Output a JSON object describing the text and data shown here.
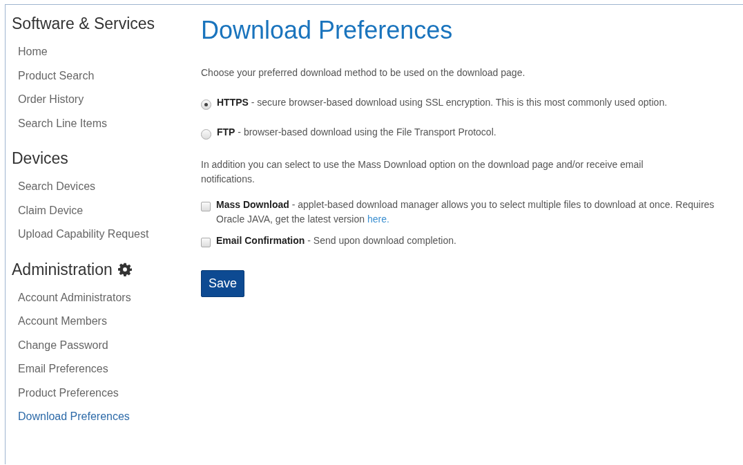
{
  "sidebar": {
    "sections": [
      {
        "heading": "Software & Services",
        "gear": false,
        "items": [
          {
            "label": "Home",
            "selected": false
          },
          {
            "label": "Product Search",
            "selected": false
          },
          {
            "label": "Order History",
            "selected": false
          },
          {
            "label": "Search Line Items",
            "selected": false
          }
        ]
      },
      {
        "heading": "Devices",
        "gear": false,
        "items": [
          {
            "label": "Search Devices",
            "selected": false
          },
          {
            "label": "Claim Device",
            "selected": false
          },
          {
            "label": "Upload Capability Request",
            "selected": false
          }
        ]
      },
      {
        "heading": "Administration",
        "gear": true,
        "items": [
          {
            "label": "Account Administrators",
            "selected": false
          },
          {
            "label": "Account Members",
            "selected": false
          },
          {
            "label": "Change Password",
            "selected": false
          },
          {
            "label": "Email Preferences",
            "selected": false
          },
          {
            "label": "Product Preferences",
            "selected": false
          },
          {
            "label": "Download Preferences",
            "selected": true
          }
        ]
      }
    ]
  },
  "main": {
    "title": "Download Preferences",
    "intro": "Choose your preferred download method to be used on the download page.",
    "methods": [
      {
        "text": "**HTTPS** - secure browser-based download using SSL encryption. This is this most commonly used option.",
        "selected": true
      },
      {
        "text": "**FTP** - browser-based download using the File Transport Protocol.",
        "selected": false
      }
    ],
    "extras_intro": "In addition you can select to use the Mass Download option on the download page and/or receive email notifications.",
    "extras": [
      {
        "text": "**Mass Download** - applet-based download manager allows you to select multiple files to download at once. Requires Oracle JAVA, get the latest version",
        "link": "here.",
        "checked": false
      },
      {
        "text": "**Email Confirmation** - Send upon download completion.",
        "checked": false
      }
    ],
    "save": "Save"
  }
}
